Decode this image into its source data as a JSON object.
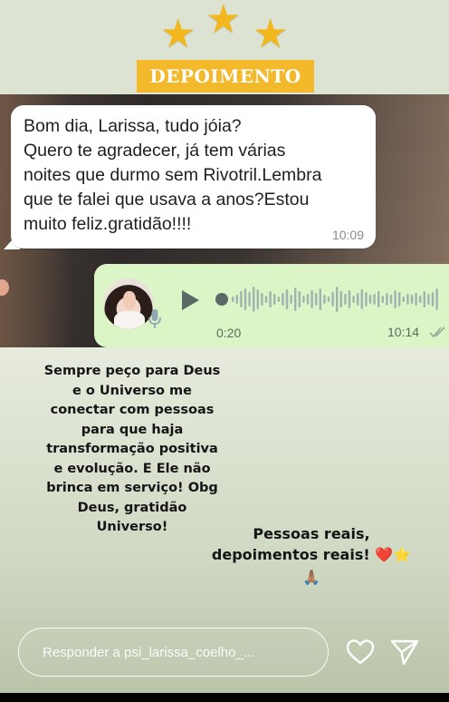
{
  "story": {
    "stars": [
      "star-icon",
      "star-icon",
      "star-icon"
    ],
    "title": "DEPOIMENTO",
    "message": {
      "text": "Bom dia, Larissa, tudo jóia?\nQuero te agradecer, já tem várias\nnoites que durmo sem Rivotril.Lembra\nque te falei que usava a anos?Estou\nmuito feliz.gratidão!!!!",
      "time": "10:09"
    },
    "voice_message": {
      "duration": "0:20",
      "time": "10:14",
      "progress": 0.0
    },
    "caption_left": "Sempre peço para Deus\ne o Universo me\nconectar com pessoas\npara que haja\ntransformação positiva\ne evolução. E Ele não\nbrinca em serviço! Obg\nDeus, gratidão\nUniverso!",
    "caption_right": {
      "text": "Pessoas reais,\ndepoimentos reais!",
      "emojis": [
        "❤️",
        "⭐",
        "🙏🏽"
      ]
    }
  },
  "reply": {
    "placeholder": "Responder a psi_larissa_coelho_..."
  },
  "colors": {
    "badge": "#f4b92a",
    "star": "#f2b71d",
    "voice_bubble": "#dcf5c7",
    "message_bubble": "#ffffff"
  }
}
